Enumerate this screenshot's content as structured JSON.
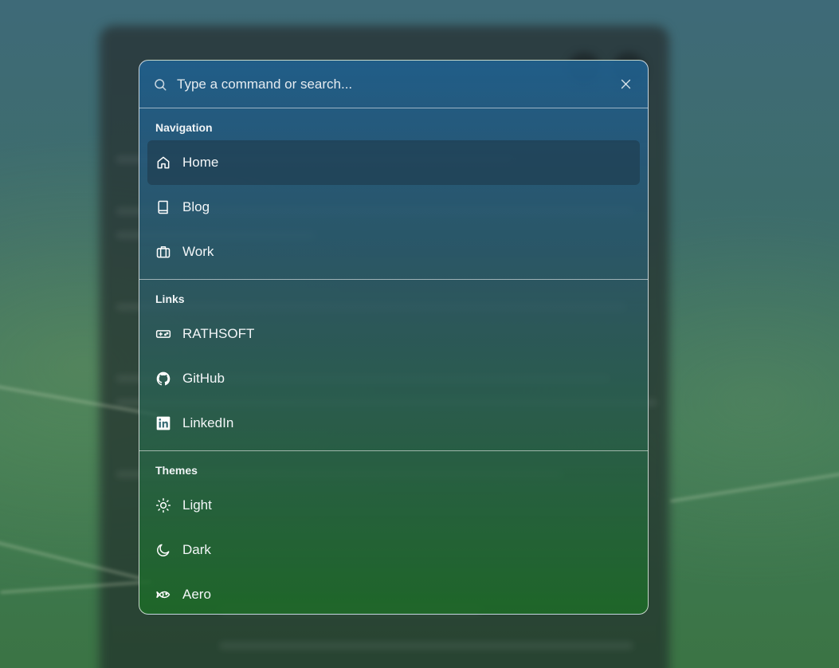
{
  "search": {
    "placeholder": "Type a command or search...",
    "icon": "search-icon",
    "close_icon": "close-icon"
  },
  "groups": [
    {
      "heading": "Navigation",
      "items": [
        {
          "label": "Home",
          "icon": "home-icon",
          "active": true
        },
        {
          "label": "Blog",
          "icon": "book-icon",
          "active": false
        },
        {
          "label": "Work",
          "icon": "briefcase-icon",
          "active": false
        }
      ]
    },
    {
      "heading": "Links",
      "items": [
        {
          "label": "RATHSOFT",
          "icon": "gamepad-icon",
          "active": false
        },
        {
          "label": "GitHub",
          "icon": "github-icon",
          "active": false
        },
        {
          "label": "LinkedIn",
          "icon": "linkedin-icon",
          "active": false
        }
      ]
    },
    {
      "heading": "Themes",
      "items": [
        {
          "label": "Light",
          "icon": "sun-icon",
          "active": false
        },
        {
          "label": "Dark",
          "icon": "moon-icon",
          "active": false
        },
        {
          "label": "Aero",
          "icon": "fish-icon",
          "active": false
        }
      ]
    }
  ],
  "colors": {
    "palette_top": "#20608e",
    "palette_bottom": "#1e6928",
    "active_item": "#1e3746",
    "text": "#f3f6f8"
  }
}
